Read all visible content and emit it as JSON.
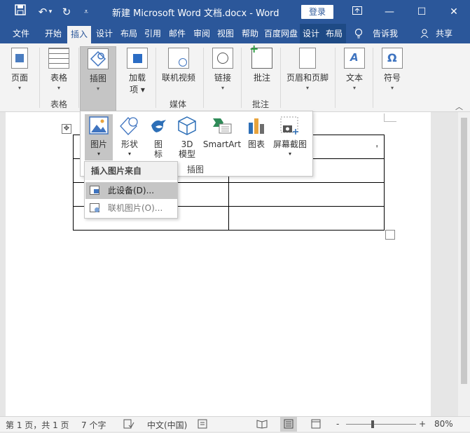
{
  "window": {
    "title": "新建 Microsoft Word 文档.docx  -  Word",
    "login_label": "登录",
    "accent_color": "#2b579a"
  },
  "quick_access": {
    "save_icon": "save-icon",
    "undo_icon": "undo-icon",
    "redo_icon": "redo-icon",
    "customize_icon": "customize-icon"
  },
  "tabs": [
    {
      "label": "文件"
    },
    {
      "label": "开始"
    },
    {
      "label": "插入",
      "active": true
    },
    {
      "label": "设计"
    },
    {
      "label": "布局"
    },
    {
      "label": "引用"
    },
    {
      "label": "邮件"
    },
    {
      "label": "审阅"
    },
    {
      "label": "视图"
    },
    {
      "label": "帮助"
    },
    {
      "label": "百度网盘"
    },
    {
      "label": "设计"
    },
    {
      "label": "布局"
    },
    {
      "label": "告诉我"
    },
    {
      "label": "共享"
    }
  ],
  "ribbon": {
    "page": "页面",
    "table": "表格",
    "illustrations": "插图",
    "addins_line1": "加载",
    "addins_line2": "项",
    "online_video": "联机视频",
    "links": "链接",
    "comment": "批注",
    "header_footer": "页眉和页脚",
    "text": "文本",
    "symbols": "符号",
    "groups": {
      "table": "表格",
      "media": "媒体",
      "comments": "批注"
    }
  },
  "illustrations_menu": {
    "pictures": "图片",
    "shapes": "形状",
    "icons_line1": "图",
    "icons_line2": "标",
    "model3d_line1": "3D",
    "model3d_line2": "模型",
    "smartart": "SmartArt",
    "chart": "图表",
    "screenshot": "屏幕截图",
    "group_label": "插图"
  },
  "picture_source_menu": {
    "header": "插入图片来自",
    "this_device": "此设备(D)...",
    "online_pictures": "联机图片(O)..."
  },
  "document": {
    "partial_cell_text": "'"
  },
  "statusbar": {
    "page": "第 1 页，共 1 页",
    "words": "7 个字",
    "language": "中文(中国)",
    "zoom": "80%",
    "zoom_minus": "-",
    "zoom_plus": "+"
  }
}
